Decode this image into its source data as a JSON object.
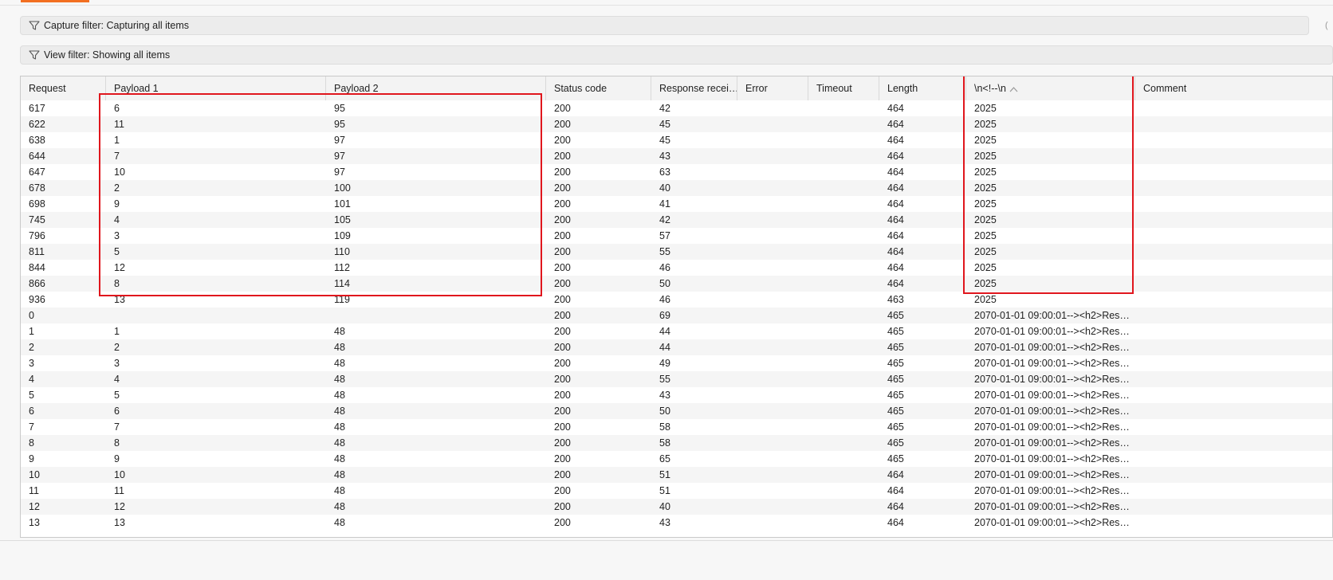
{
  "filters": {
    "capture_label": "Capture filter: Capturing all items",
    "view_label": "View filter: Showing all items",
    "filter_icon": "funnel-icon"
  },
  "table": {
    "columns": [
      "Request",
      "Payload 1",
      "Payload 2",
      "Status code",
      "Response recei…",
      "Error",
      "Timeout",
      "Length",
      "\\n<!--\\n",
      "Comment"
    ],
    "sort_column": "\\n<!--\\n",
    "sort_direction": "ascending",
    "rows": [
      [
        "617",
        "6",
        "95",
        "200",
        "42",
        "",
        "",
        "464",
        "2025",
        ""
      ],
      [
        "622",
        "11",
        "95",
        "200",
        "45",
        "",
        "",
        "464",
        "2025",
        ""
      ],
      [
        "638",
        "1",
        "97",
        "200",
        "45",
        "",
        "",
        "464",
        "2025",
        ""
      ],
      [
        "644",
        "7",
        "97",
        "200",
        "43",
        "",
        "",
        "464",
        "2025",
        ""
      ],
      [
        "647",
        "10",
        "97",
        "200",
        "63",
        "",
        "",
        "464",
        "2025",
        ""
      ],
      [
        "678",
        "2",
        "100",
        "200",
        "40",
        "",
        "",
        "464",
        "2025",
        ""
      ],
      [
        "698",
        "9",
        "101",
        "200",
        "41",
        "",
        "",
        "464",
        "2025",
        ""
      ],
      [
        "745",
        "4",
        "105",
        "200",
        "42",
        "",
        "",
        "464",
        "2025",
        ""
      ],
      [
        "796",
        "3",
        "109",
        "200",
        "57",
        "",
        "",
        "464",
        "2025",
        ""
      ],
      [
        "811",
        "5",
        "110",
        "200",
        "55",
        "",
        "",
        "464",
        "2025",
        ""
      ],
      [
        "844",
        "12",
        "112",
        "200",
        "46",
        "",
        "",
        "464",
        "2025",
        ""
      ],
      [
        "866",
        "8",
        "114",
        "200",
        "50",
        "",
        "",
        "464",
        "2025",
        ""
      ],
      [
        "936",
        "13",
        "119",
        "200",
        "46",
        "",
        "",
        "463",
        "2025",
        ""
      ],
      [
        "0",
        "",
        "",
        "200",
        "69",
        "",
        "",
        "465",
        "2070-01-01 09:00:01--><h2>Res…",
        ""
      ],
      [
        "1",
        "1",
        "48",
        "200",
        "44",
        "",
        "",
        "465",
        "2070-01-01 09:00:01--><h2>Res…",
        ""
      ],
      [
        "2",
        "2",
        "48",
        "200",
        "44",
        "",
        "",
        "465",
        "2070-01-01 09:00:01--><h2>Res…",
        ""
      ],
      [
        "3",
        "3",
        "48",
        "200",
        "49",
        "",
        "",
        "465",
        "2070-01-01 09:00:01--><h2>Res…",
        ""
      ],
      [
        "4",
        "4",
        "48",
        "200",
        "55",
        "",
        "",
        "465",
        "2070-01-01 09:00:01--><h2>Res…",
        ""
      ],
      [
        "5",
        "5",
        "48",
        "200",
        "43",
        "",
        "",
        "465",
        "2070-01-01 09:00:01--><h2>Res…",
        ""
      ],
      [
        "6",
        "6",
        "48",
        "200",
        "50",
        "",
        "",
        "465",
        "2070-01-01 09:00:01--><h2>Res…",
        ""
      ],
      [
        "7",
        "7",
        "48",
        "200",
        "58",
        "",
        "",
        "465",
        "2070-01-01 09:00:01--><h2>Res…",
        ""
      ],
      [
        "8",
        "8",
        "48",
        "200",
        "58",
        "",
        "",
        "465",
        "2070-01-01 09:00:01--><h2>Res…",
        ""
      ],
      [
        "9",
        "9",
        "48",
        "200",
        "65",
        "",
        "",
        "465",
        "2070-01-01 09:00:01--><h2>Res…",
        ""
      ],
      [
        "10",
        "10",
        "48",
        "200",
        "51",
        "",
        "",
        "464",
        "2070-01-01 09:00:01--><h2>Res…",
        ""
      ],
      [
        "11",
        "11",
        "48",
        "200",
        "51",
        "",
        "",
        "464",
        "2070-01-01 09:00:01--><h2>Res…",
        ""
      ],
      [
        "12",
        "12",
        "48",
        "200",
        "40",
        "",
        "",
        "464",
        "2070-01-01 09:00:01--><h2>Res…",
        ""
      ],
      [
        "13",
        "13",
        "48",
        "200",
        "43",
        "",
        "",
        "464",
        "2070-01-01 09:00:01--><h2>Res…",
        ""
      ]
    ]
  },
  "annotations": {
    "highlight_color": "#e0161d"
  },
  "colors": {
    "accent": "#f26f21"
  }
}
